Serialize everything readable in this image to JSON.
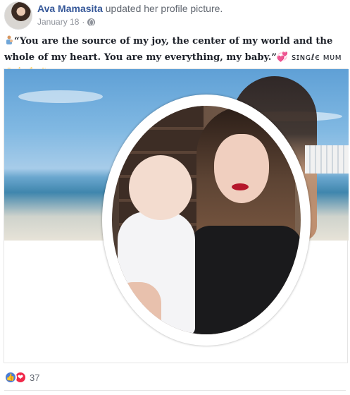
{
  "post": {
    "author_name": "Ava Mamasita",
    "action": "updated her profile picture.",
    "date": "January 18",
    "separator": "·",
    "privacy_icon": "globe-icon",
    "text_main": "“You are the source of my joy, the center of my world and the whole of my heart. You are my everything, my baby.”",
    "text_single": "ꜱɪɴɢℓє мυм",
    "emojis": {
      "person": "person-feeding-baby-emoji",
      "heart": "💞",
      "kiss": "😘",
      "finger": "🖕",
      "flex": "💪",
      "fist": "👊"
    }
  },
  "reactions": {
    "like_icon": "👍",
    "love_icon": "❤",
    "count": "37"
  },
  "colors": {
    "author_link": "#365899",
    "meta_text": "#90949c",
    "like_blue": "#4a7dd6",
    "love_red": "#f0284a"
  }
}
